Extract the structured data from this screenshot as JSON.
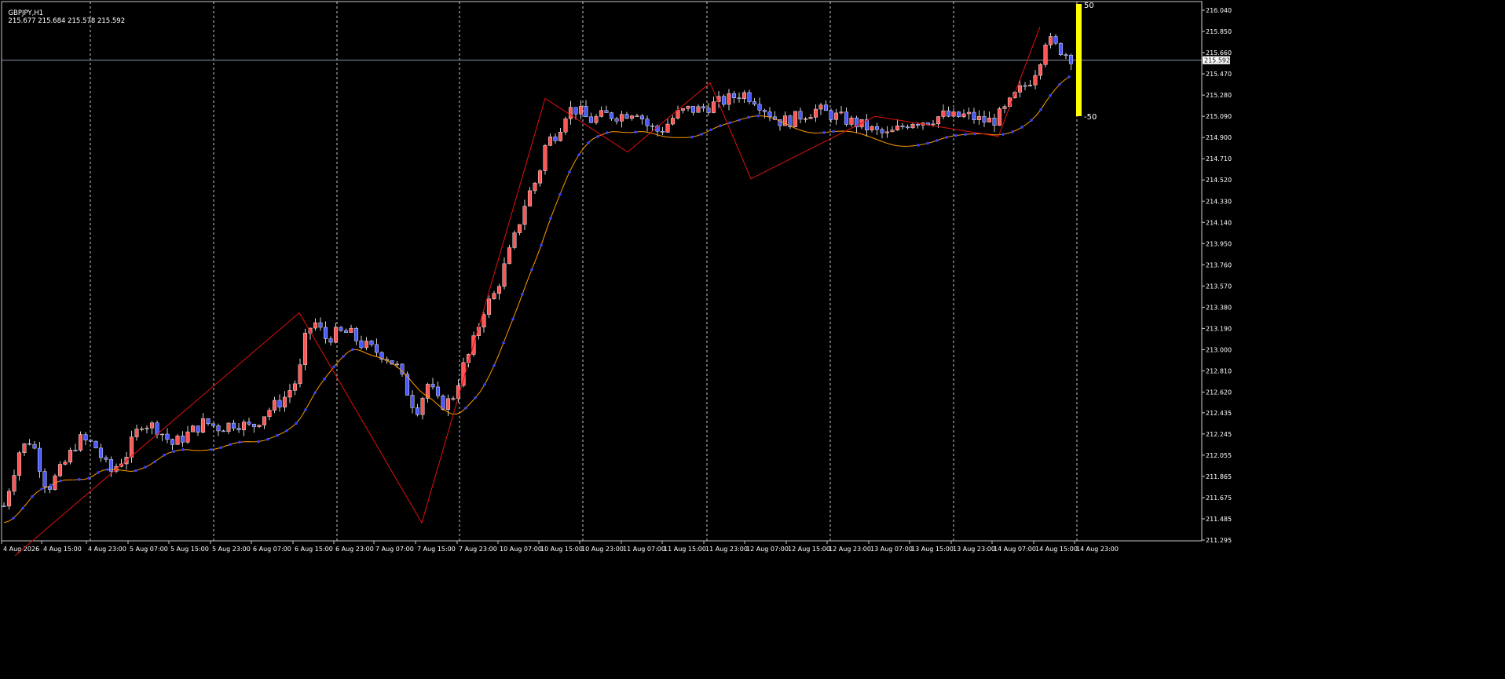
{
  "chart_header": {
    "symbol_tf": "GBPJPY,H1",
    "ohlc": "215.677 215.684 215.578 215.592"
  },
  "chart_data": {
    "type": "candlestick",
    "symbol": "GBPJPY",
    "timeframe": "H1",
    "ylim": [
      211.295,
      216.04
    ],
    "price_ticks": [
      "216.040",
      "215.850",
      "215.660",
      "215.470",
      "215.280",
      "215.090",
      "214.900",
      "214.710",
      "214.520",
      "214.330",
      "214.140",
      "213.950",
      "213.760",
      "213.570",
      "213.380",
      "213.190",
      "213.000",
      "212.810",
      "212.620",
      "212.435",
      "212.245",
      "212.055",
      "211.865",
      "211.675",
      "211.485",
      "211.295"
    ],
    "current_price": "215.592",
    "time_labels": [
      "4 Aug 2026",
      "4 Aug 15:00",
      "4 Aug 23:00",
      "5 Aug 07:00",
      "5 Aug 15:00",
      "5 Aug 23:00",
      "6 Aug 07:00",
      "6 Aug 15:00",
      "6 Aug 23:00",
      "7 Aug 07:00",
      "7 Aug 15:00",
      "7 Aug 23:00",
      "10 Aug 07:00",
      "10 Aug 15:00",
      "10 Aug 23:00",
      "11 Aug 07:00",
      "11 Aug 15:00",
      "11 Aug 23:00",
      "12 Aug 07:00",
      "12 Aug 15:00",
      "12 Aug 23:00",
      "13 Aug 07:00",
      "13 Aug 15:00",
      "13 Aug 23:00",
      "14 Aug 07:00",
      "14 Aug 15:00",
      "14 Aug 23:00"
    ],
    "grid": "vertical-dashed",
    "zigzag_points": [
      {
        "time": "4 Aug 2026",
        "price": 211.1
      },
      {
        "time": "6 Aug 15:00",
        "price": 213.33
      },
      {
        "time": "7 Aug 15:00",
        "price": 211.45
      },
      {
        "time": "10 Aug 15:00",
        "price": 215.25
      },
      {
        "time": "11 Aug 07:00",
        "price": 214.77
      },
      {
        "time": "11 Aug 23:00",
        "price": 215.39
      },
      {
        "time": "12 Aug 07:00",
        "price": 214.53
      },
      {
        "time": "13 Aug 07:00",
        "price": 215.09
      },
      {
        "time": "14 Aug 07:00",
        "price": 214.91
      },
      {
        "time": "14 Aug 15:00",
        "price": 215.89
      }
    ],
    "oscillator_levels": [
      "50",
      "-50"
    ],
    "colors": {
      "up_candle": "#ff5555",
      "down_candle": "#4a5aff",
      "zigzag": "#e01010",
      "ma": "#ff9900",
      "dots": "#3344ff",
      "osc": "#ffff00"
    }
  }
}
